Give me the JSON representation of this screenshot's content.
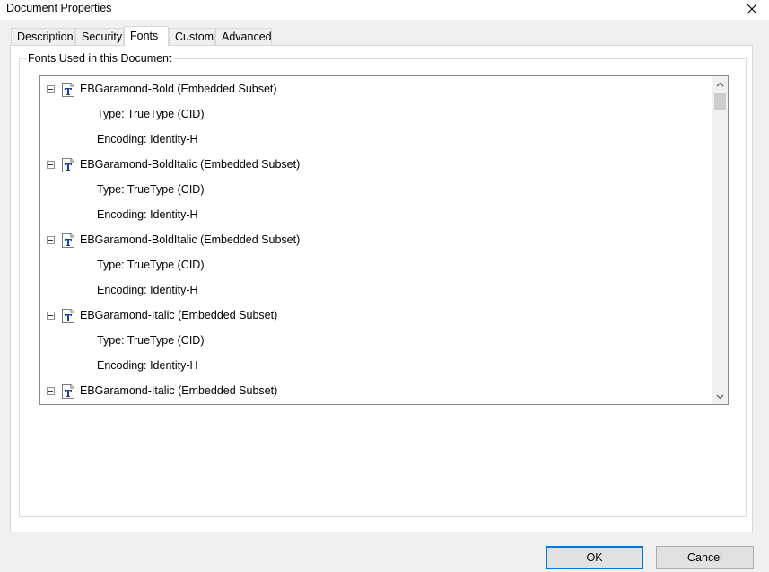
{
  "window": {
    "title": "Document Properties",
    "close_icon": "close-icon"
  },
  "tabs": [
    {
      "label": "Description",
      "active": false
    },
    {
      "label": "Security",
      "active": false
    },
    {
      "label": "Fonts",
      "active": true
    },
    {
      "label": "Custom",
      "active": false
    },
    {
      "label": "Advanced",
      "active": false
    }
  ],
  "fonts_group": {
    "legend": "Fonts Used in this Document",
    "font_icon": "truetype-font-icon",
    "toggle_icon": "collapse-minus-icon",
    "fonts": [
      {
        "name": "EBGaramond-Bold (Embedded Subset)",
        "type": "Type: TrueType (CID)",
        "encoding": "Encoding: Identity-H"
      },
      {
        "name": "EBGaramond-BoldItalic (Embedded Subset)",
        "type": "Type: TrueType (CID)",
        "encoding": "Encoding: Identity-H"
      },
      {
        "name": "EBGaramond-BoldItalic (Embedded Subset)",
        "type": "Type: TrueType (CID)",
        "encoding": "Encoding: Identity-H"
      },
      {
        "name": "EBGaramond-Italic (Embedded Subset)",
        "type": "Type: TrueType (CID)",
        "encoding": "Encoding: Identity-H"
      },
      {
        "name": "EBGaramond-Italic (Embedded Subset)",
        "type": "",
        "encoding": ""
      }
    ]
  },
  "buttons": {
    "ok": "OK",
    "cancel": "Cancel"
  },
  "colors": {
    "focus_border": "#0078d7",
    "font_icon_blue": "#1a3fa0"
  }
}
